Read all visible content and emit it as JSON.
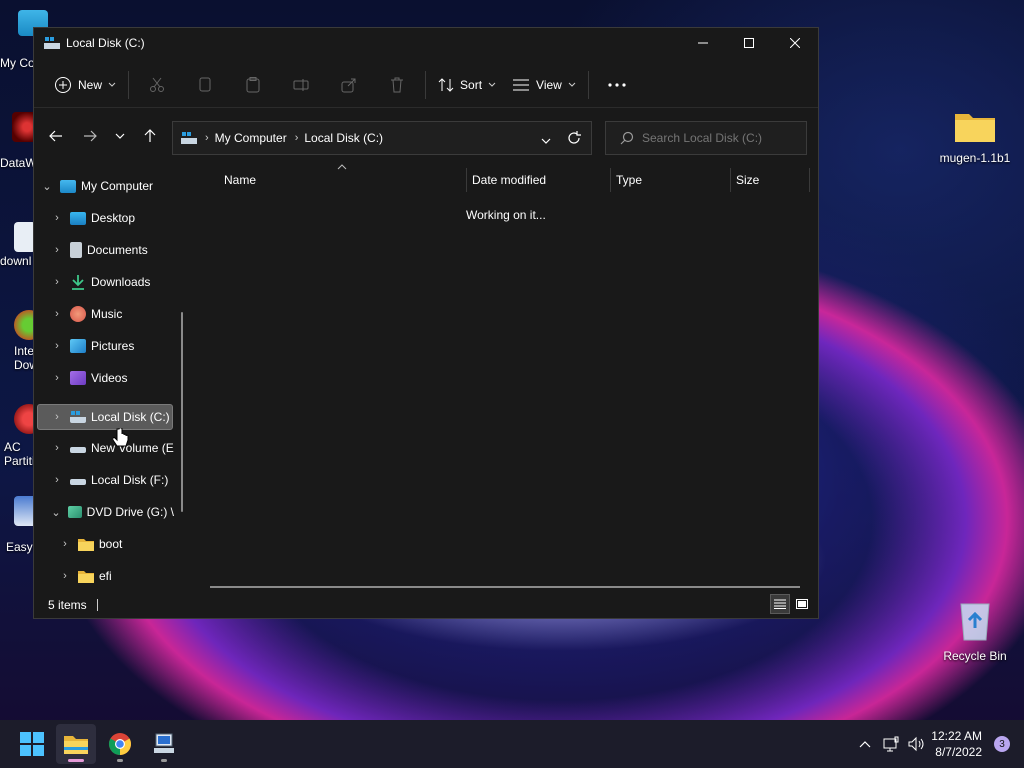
{
  "desktop": {
    "left_icons": [
      {
        "label": "My Co",
        "icon": "computer-icon"
      },
      {
        "label": "DataW",
        "icon": "datawhale-icon"
      },
      {
        "label": "downl",
        "icon": "download-file-icon"
      },
      {
        "label": "Inte Dow",
        "icon": "internet-download-icon"
      },
      {
        "label": "AC Partiti",
        "icon": "partition-icon"
      },
      {
        "label": "EasyB",
        "icon": "easybcd-icon"
      }
    ],
    "right_icons": [
      {
        "label": "mugen-1.1b1",
        "icon": "folder-icon"
      },
      {
        "label": "Recycle Bin",
        "icon": "recycle-bin-icon"
      }
    ]
  },
  "window": {
    "title": "Local Disk (C:)",
    "controls": [
      "minimize",
      "maximize",
      "close"
    ],
    "commandbar": {
      "new_label": "New",
      "sort_label": "Sort",
      "view_label": "View"
    },
    "address": {
      "crumbs": [
        "My Computer",
        "Local Disk (C:)"
      ]
    },
    "search": {
      "placeholder": "Search Local Disk (C:)"
    },
    "navpane": {
      "items": [
        {
          "label": "My Computer",
          "icon": "computer-icon",
          "expanded": true
        },
        {
          "label": "Desktop",
          "icon": "desktop-icon"
        },
        {
          "label": "Documents",
          "icon": "documents-icon"
        },
        {
          "label": "Downloads",
          "icon": "downloads-icon"
        },
        {
          "label": "Music",
          "icon": "music-icon"
        },
        {
          "label": "Pictures",
          "icon": "pictures-icon"
        },
        {
          "label": "Videos",
          "icon": "videos-icon"
        },
        {
          "label": "Local Disk (C:)",
          "icon": "drive-icon",
          "selected": true
        },
        {
          "label": "New Volume (E",
          "icon": "drive-icon"
        },
        {
          "label": "Local Disk (F:)",
          "icon": "drive-icon"
        },
        {
          "label": "DVD Drive (G:) \\",
          "icon": "dvd-icon",
          "expanded": true
        },
        {
          "label": "boot",
          "icon": "folder-icon"
        },
        {
          "label": "efi",
          "icon": "folder-icon"
        }
      ]
    },
    "columns": [
      "Name",
      "Date modified",
      "Type",
      "Size"
    ],
    "status_message": "Working on it...",
    "statusbar": {
      "item_count": "5 items"
    }
  },
  "taskbar": {
    "apps": [
      "start-icon",
      "file-explorer-icon",
      "chrome-icon",
      "network-computer-icon"
    ],
    "clock": {
      "time": "12:22 AM",
      "date": "8/7/2022"
    },
    "notification_count": "3"
  },
  "colors": {
    "accent": "#60cdff",
    "folder": "#f3c94c",
    "selection": "#5b5b5b"
  }
}
